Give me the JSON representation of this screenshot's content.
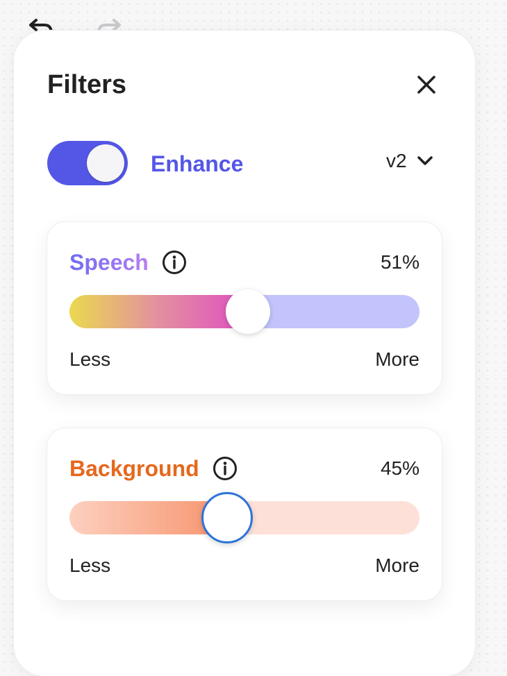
{
  "panel": {
    "title": "Filters"
  },
  "enhance": {
    "label": "Enhance",
    "enabled": true,
    "version": "v2",
    "accent_color": "#5457e6"
  },
  "filters": {
    "speech": {
      "label": "Speech",
      "value": 51,
      "value_text": "51%",
      "min_label": "Less",
      "max_label": "More",
      "label_color_start": "#6f6cf4",
      "label_color_end": "#b77ff0",
      "track_fill_gradient": [
        "#ead94f",
        "#e38fa0",
        "#df4fc0"
      ],
      "track_rest_color": "#c3c4fb"
    },
    "background": {
      "label": "Background",
      "value": 45,
      "value_text": "45%",
      "min_label": "Less",
      "max_label": "More",
      "label_color": "#e5681e",
      "track_fill_gradient": [
        "#fdd0bf",
        "#f6946d"
      ],
      "track_rest_color": "#fde1d8",
      "focus_ring_color": "#2c73d9"
    }
  },
  "icons": {
    "undo": "undo-arrow-icon",
    "redo": "redo-arrow-icon",
    "close": "close-x-icon",
    "chevron": "chevron-down-icon",
    "info": "info-circle-icon"
  }
}
